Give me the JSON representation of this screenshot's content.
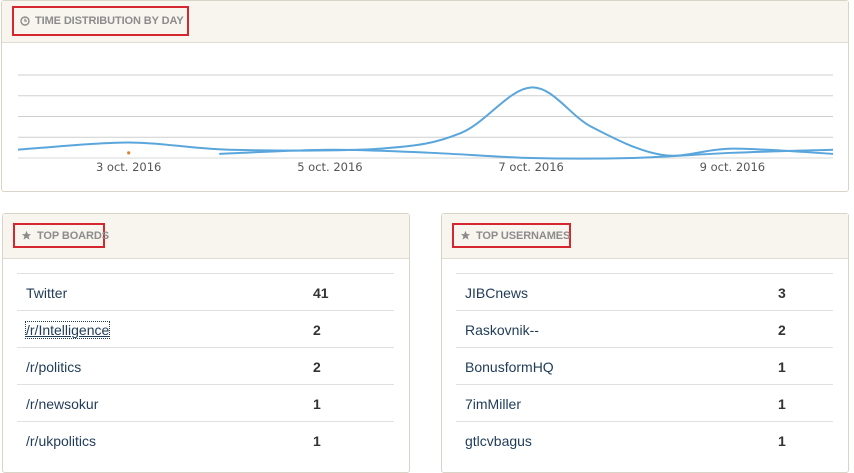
{
  "time_panel": {
    "title": "TIME DISTRIBUTION BY DAY",
    "icon": "clock-icon"
  },
  "chart_data": {
    "type": "line",
    "x_ticks": [
      "3 oct. 2016",
      "5 oct. 2016",
      "7 oct. 2016",
      "9 oct. 2016"
    ],
    "series": [
      {
        "color": "#5aa6dc",
        "points": [
          [
            1.9,
            0.4
          ],
          [
            3.0,
            0.75
          ],
          [
            4.0,
            0.4
          ],
          [
            5.5,
            0.45
          ],
          [
            6.3,
            1.2
          ],
          [
            7.0,
            3.4
          ],
          [
            7.6,
            1.5
          ],
          [
            8.3,
            0.15
          ],
          [
            9.0,
            0.45
          ],
          [
            10.0,
            0.2
          ]
        ]
      },
      {
        "color": "#5aa6dc",
        "points": [
          [
            3.9,
            0.2
          ],
          [
            5.0,
            0.4
          ],
          [
            6.0,
            0.25
          ],
          [
            7.0,
            0.0
          ],
          [
            8.0,
            0.0
          ],
          [
            9.0,
            0.25
          ],
          [
            10.0,
            0.4
          ]
        ]
      }
    ],
    "marker": {
      "x": 3.0,
      "y": 0.15,
      "color": "#e0822d"
    },
    "xlim": [
      1.9,
      10.0
    ],
    "ylim": [
      0,
      4
    ],
    "grid": true,
    "legend": "none"
  },
  "boards": {
    "title": "TOP BOARDS",
    "icon": "star-icon",
    "rows": [
      {
        "label": "Twitter",
        "count": "41"
      },
      {
        "label": "/r/Intelligence",
        "count": "2"
      },
      {
        "label": "/r/politics",
        "count": "2"
      },
      {
        "label": "/r/newsokur",
        "count": "1"
      },
      {
        "label": "/r/ukpolitics",
        "count": "1"
      }
    ]
  },
  "usernames": {
    "title": "TOP USERNAMES",
    "icon": "star-icon",
    "rows": [
      {
        "label": "JIBCnews",
        "count": "3"
      },
      {
        "label": "Raskovnik--",
        "count": "2"
      },
      {
        "label": "BonusformHQ",
        "count": "1"
      },
      {
        "label": "7imMiller",
        "count": "1"
      },
      {
        "label": "gtlcvbagus",
        "count": "1"
      }
    ]
  },
  "colors": {
    "accent": "#d6262f",
    "line": "#5aa6dc",
    "header_bg": "#f8f5ef"
  }
}
